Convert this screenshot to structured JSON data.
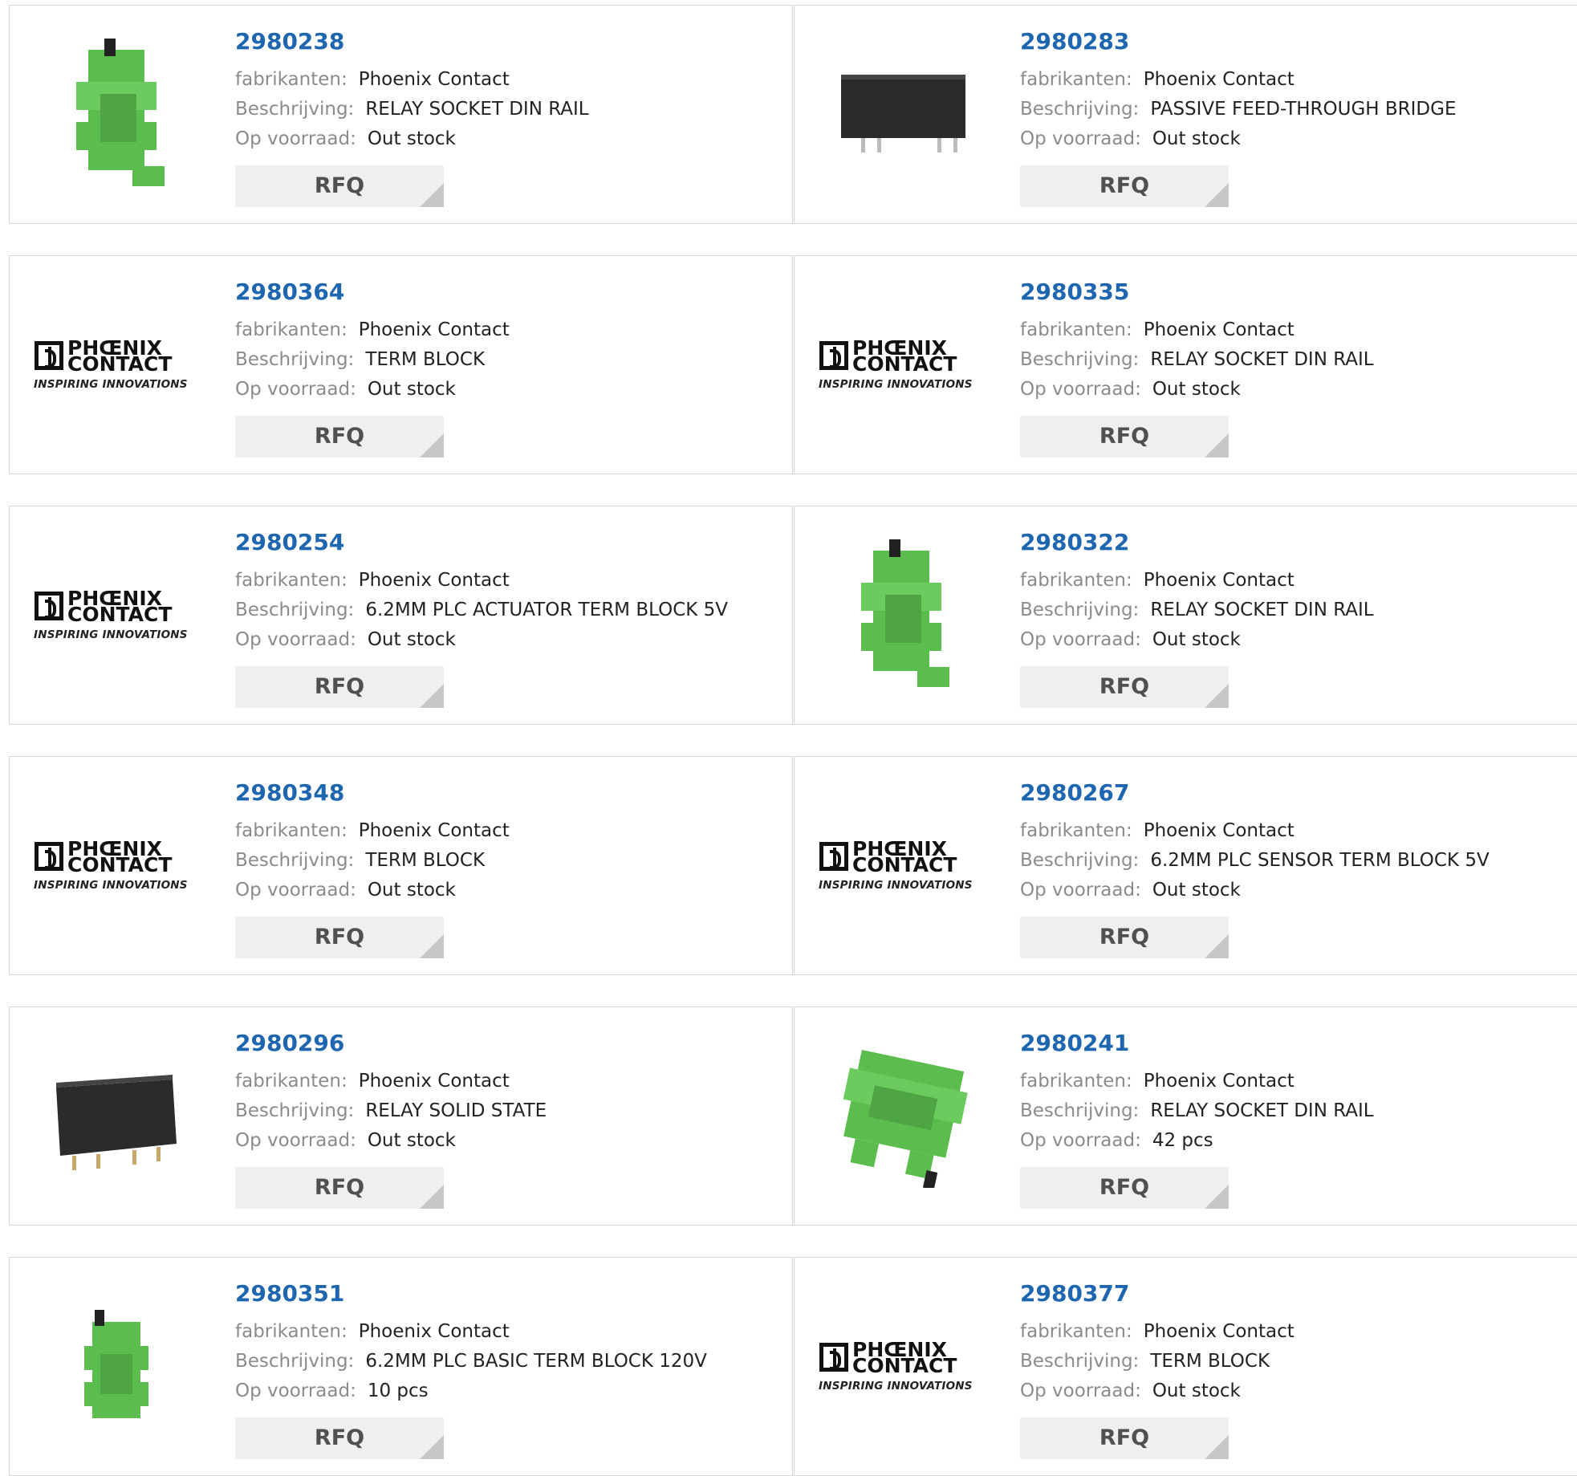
{
  "labels": {
    "manufacturer": "fabrikanten:",
    "description": "Beschrijving:",
    "stock": "Op voorraad:",
    "rfq": "RFQ"
  },
  "logo": {
    "line1": "PHŒNIX",
    "line2": "CONTACT",
    "tagline": "INSPIRING INNOVATIONS"
  },
  "colors": {
    "part_number": "#1f66b0",
    "relay_green": "#5cbd4f",
    "solid_state_black": "#2b2b2b"
  },
  "products": [
    {
      "part": "2980238",
      "manufacturer": "Phoenix Contact",
      "description": "RELAY SOCKET DIN RAIL",
      "stock": "Out stock",
      "image": "green-relay-socket-icon"
    },
    {
      "part": "2980283",
      "manufacturer": "Phoenix Contact",
      "description": "PASSIVE FEED-THROUGH BRIDGE",
      "stock": "Out stock",
      "image": "black-bridge-module-icon"
    },
    {
      "part": "2980364",
      "manufacturer": "Phoenix Contact",
      "description": "TERM BLOCK",
      "stock": "Out stock",
      "image": "phoenix-contact-logo"
    },
    {
      "part": "2980335",
      "manufacturer": "Phoenix Contact",
      "description": "RELAY SOCKET DIN RAIL",
      "stock": "Out stock",
      "image": "phoenix-contact-logo"
    },
    {
      "part": "2980254",
      "manufacturer": "Phoenix Contact",
      "description": "6.2MM PLC ACTUATOR TERM BLOCK 5V",
      "stock": "Out stock",
      "image": "phoenix-contact-logo"
    },
    {
      "part": "2980322",
      "manufacturer": "Phoenix Contact",
      "description": "RELAY SOCKET DIN RAIL",
      "stock": "Out stock",
      "image": "green-relay-socket-icon"
    },
    {
      "part": "2980348",
      "manufacturer": "Phoenix Contact",
      "description": "TERM BLOCK",
      "stock": "Out stock",
      "image": "phoenix-contact-logo"
    },
    {
      "part": "2980267",
      "manufacturer": "Phoenix Contact",
      "description": "6.2MM PLC SENSOR TERM BLOCK 5V",
      "stock": "Out stock",
      "image": "phoenix-contact-logo"
    },
    {
      "part": "2980296",
      "manufacturer": "Phoenix Contact",
      "description": "RELAY SOLID STATE",
      "stock": "Out stock",
      "image": "black-solid-state-relay-icon"
    },
    {
      "part": "2980241",
      "manufacturer": "Phoenix Contact",
      "description": "RELAY SOCKET DIN RAIL",
      "stock": "42 pcs",
      "image": "green-relay-socket-angled-icon"
    },
    {
      "part": "2980351",
      "manufacturer": "Phoenix Contact",
      "description": "6.2MM PLC BASIC TERM BLOCK 120V",
      "stock": "10 pcs",
      "image": "green-relay-socket-small-icon"
    },
    {
      "part": "2980377",
      "manufacturer": "Phoenix Contact",
      "description": "TERM BLOCK",
      "stock": "Out stock",
      "image": "phoenix-contact-logo"
    }
  ]
}
